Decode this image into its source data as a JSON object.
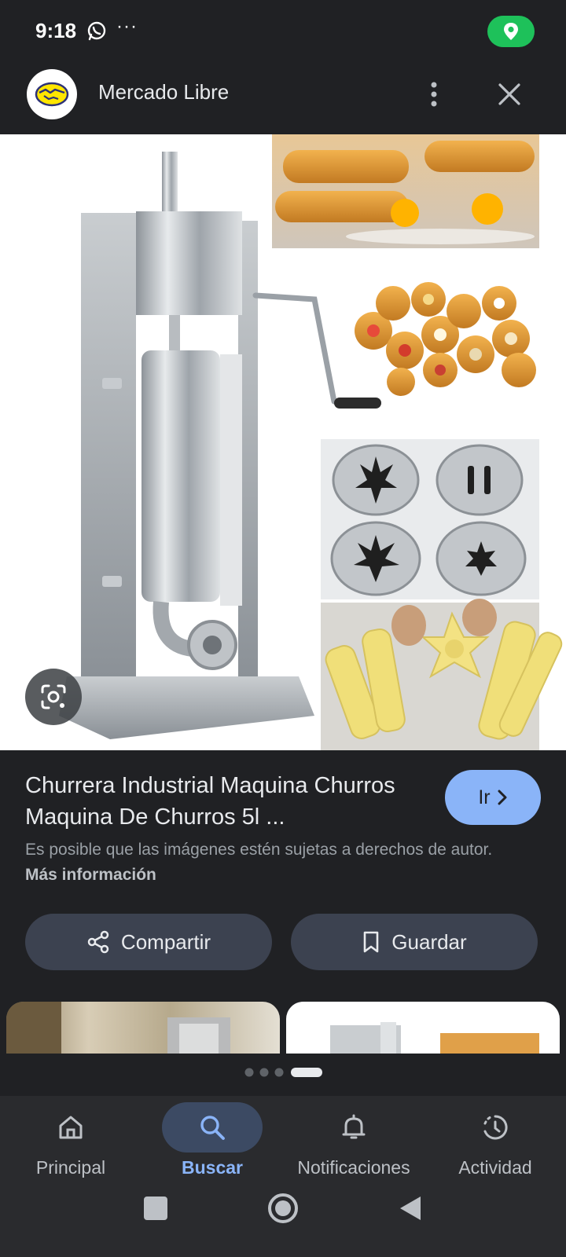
{
  "status_bar": {
    "time": "9:18",
    "more": "···"
  },
  "header": {
    "app_title": "Mercado Libre"
  },
  "result": {
    "title": "Churrera Industrial Maquina Churros Maquina De Churros 5l ...",
    "go_button": "Ir",
    "copyright_text": "Es posible que las imágenes estén sujetas a derechos de autor.",
    "more_info": "Más información"
  },
  "actions": {
    "share_label": "Compartir",
    "save_label": "Guardar"
  },
  "bottom_nav": {
    "items": [
      {
        "label": "Principal",
        "icon": "home-icon"
      },
      {
        "label": "Buscar",
        "icon": "search-icon",
        "active": true
      },
      {
        "label": "Notificaciones",
        "icon": "bell-icon"
      },
      {
        "label": "Actividad",
        "icon": "activity-icon"
      }
    ]
  },
  "colors": {
    "accent": "#8ab4f8",
    "background": "#202124",
    "location_pill": "#1ec15a"
  }
}
